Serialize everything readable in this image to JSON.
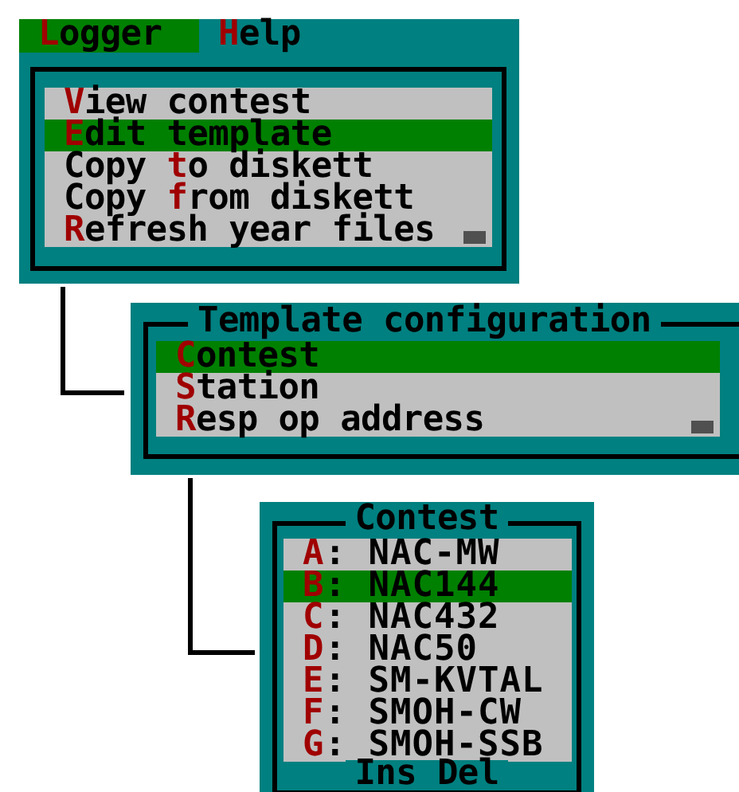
{
  "menu_bar": [
    {
      "label": "**L**ogger",
      "selected": true
    },
    {
      "label": "**H**elp",
      "selected": false
    }
  ],
  "logger_menu": {
    "items": [
      {
        "label": "**V**iew contest",
        "selected": false
      },
      {
        "label": "**E**dit template",
        "selected": true
      },
      {
        "label": "Copy **t**o diskett",
        "selected": false
      },
      {
        "label": "Copy **f**rom diskett",
        "selected": false
      },
      {
        "label": "**R**efresh year files",
        "selected": false
      }
    ]
  },
  "template_dialog": {
    "title": "Template configuration",
    "items": [
      {
        "label": "**C**ontest",
        "selected": true
      },
      {
        "label": "**S**tation",
        "selected": false
      },
      {
        "label": "**R**esp op address",
        "selected": false
      }
    ]
  },
  "contest_dialog": {
    "title": "Contest",
    "items": [
      {
        "label": "**A**: NAC-MW",
        "selected": false
      },
      {
        "label": "**B**: NAC144",
        "selected": true
      },
      {
        "label": "**C**: NAC432",
        "selected": false
      },
      {
        "label": "**D**: NAC50",
        "selected": false
      },
      {
        "label": "**E**: SM-KVTAL",
        "selected": false
      },
      {
        "label": "**F**: SMOH-CW",
        "selected": false
      },
      {
        "label": "**G**: SMOH-SSB",
        "selected": false
      }
    ],
    "footer": "Ins Del"
  }
}
